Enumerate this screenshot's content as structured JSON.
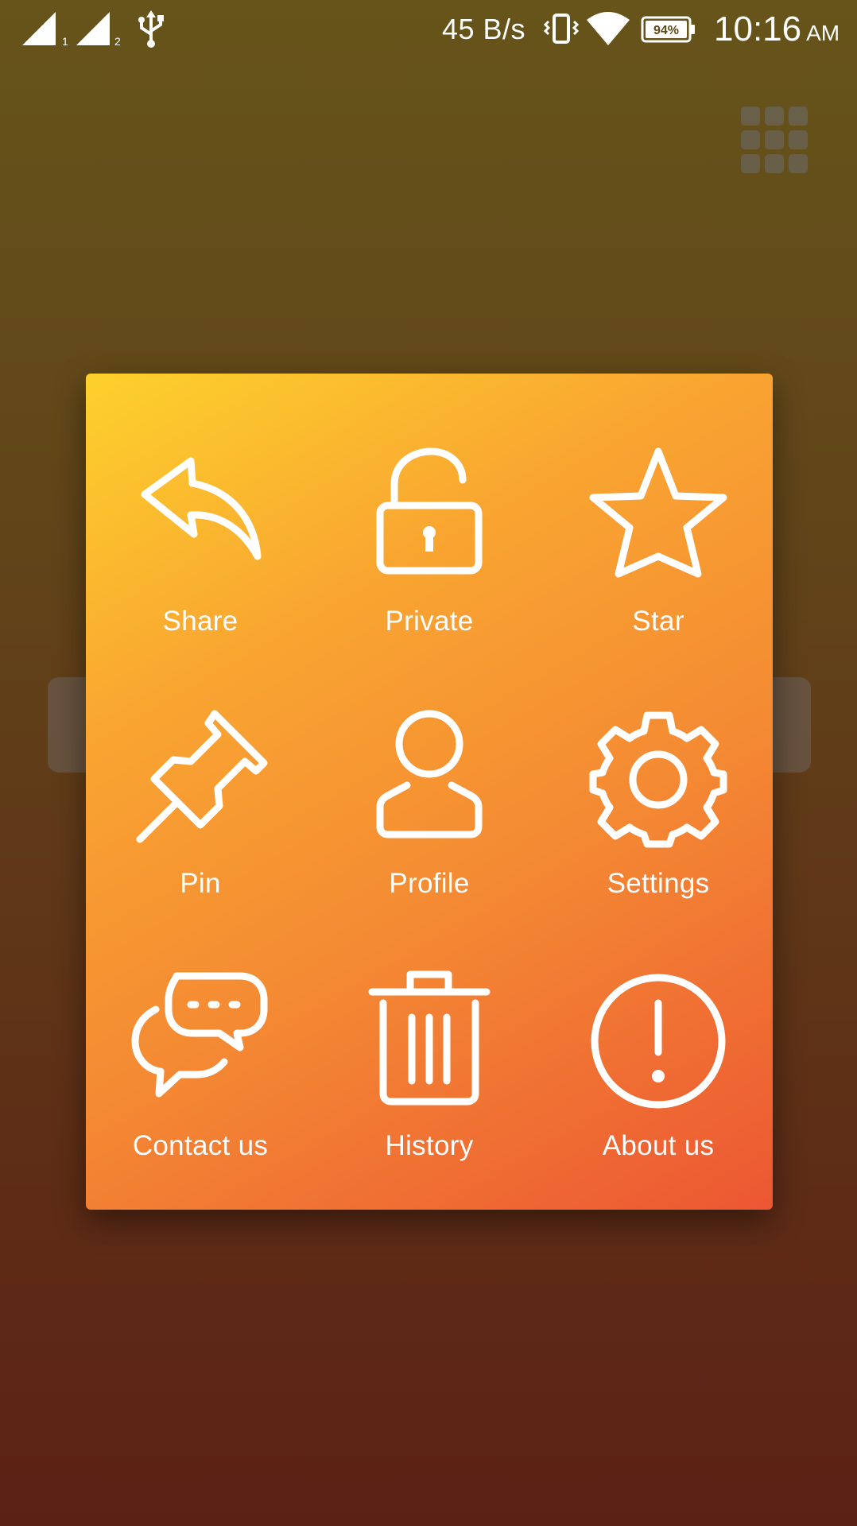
{
  "status_bar": {
    "sim1_label": "1",
    "sim2_label": "2",
    "net_speed": "45 B/s",
    "battery_level": "94%",
    "time": "10:16",
    "ampm": "AM",
    "icons": [
      "signal-sim1-icon",
      "signal-sim2-icon",
      "usb-icon",
      "vibrate-icon",
      "wifi-icon",
      "battery-icon"
    ]
  },
  "header": {
    "grid_button_icon": "grid-icon"
  },
  "menu": {
    "items": [
      {
        "label": "Share",
        "icon": "reply-arrow-icon"
      },
      {
        "label": "Private",
        "icon": "unlocked-lock-icon"
      },
      {
        "label": "Star",
        "icon": "star-icon"
      },
      {
        "label": "Pin",
        "icon": "pushpin-icon"
      },
      {
        "label": "Profile",
        "icon": "person-icon"
      },
      {
        "label": "Settings",
        "icon": "gear-icon"
      },
      {
        "label": "Contact us",
        "icon": "chat-bubbles-icon"
      },
      {
        "label": "History",
        "icon": "trash-can-icon"
      },
      {
        "label": "About us",
        "icon": "info-exclamation-icon"
      }
    ]
  },
  "colors": {
    "dialog_gradient_start": "#fdd12c",
    "dialog_gradient_end": "#ec5733",
    "background_top": "#66541a",
    "background_bottom": "#5c2115",
    "icon_color": "#ffffff"
  }
}
